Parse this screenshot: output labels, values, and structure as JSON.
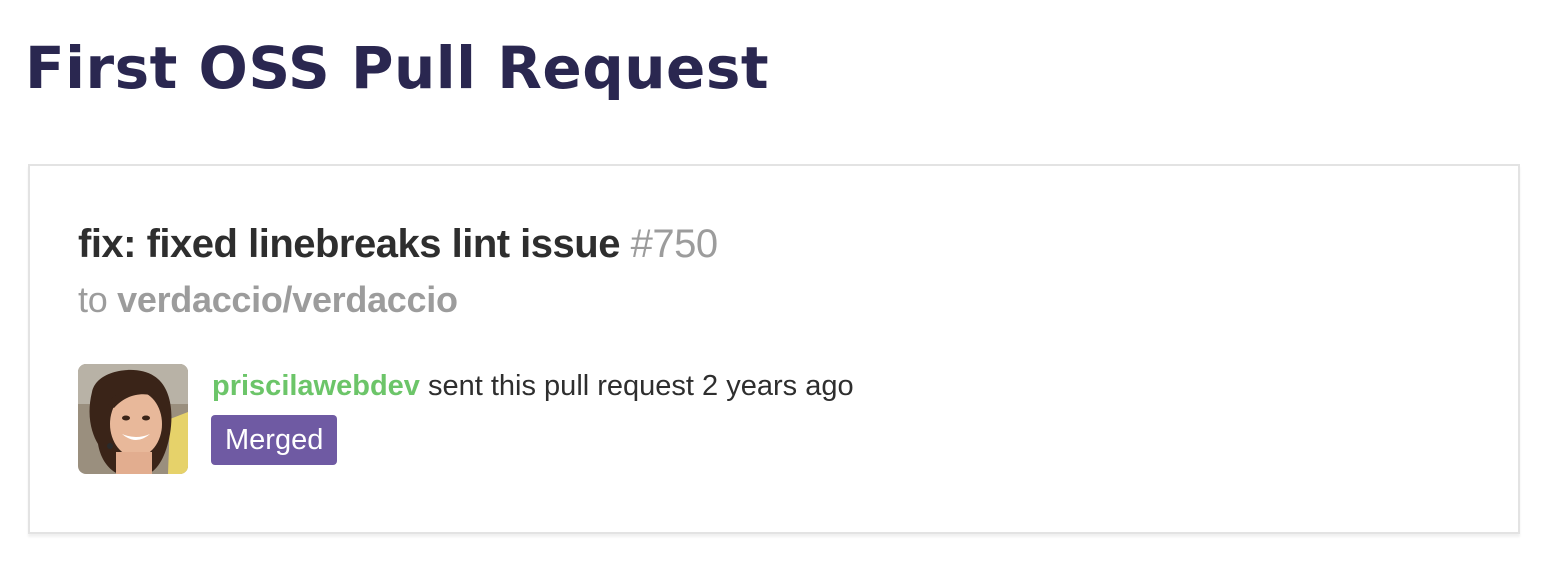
{
  "page": {
    "title": "First OSS Pull Request"
  },
  "pull_request": {
    "title": "fix: fixed linebreaks lint issue",
    "number": "#750",
    "to_prefix": "to",
    "repository": "verdaccio/verdaccio",
    "author": {
      "username": "priscilawebdev",
      "avatar_icon": "user-avatar-photo"
    },
    "action_text": "sent this pull request",
    "time_ago": "2 years ago",
    "status": "Merged"
  },
  "colors": {
    "title": "#2a2750",
    "pr_title": "#2e2e2e",
    "muted": "#9c9c9c",
    "username": "#6cc569",
    "merged_badge": "#6f5aa3"
  }
}
